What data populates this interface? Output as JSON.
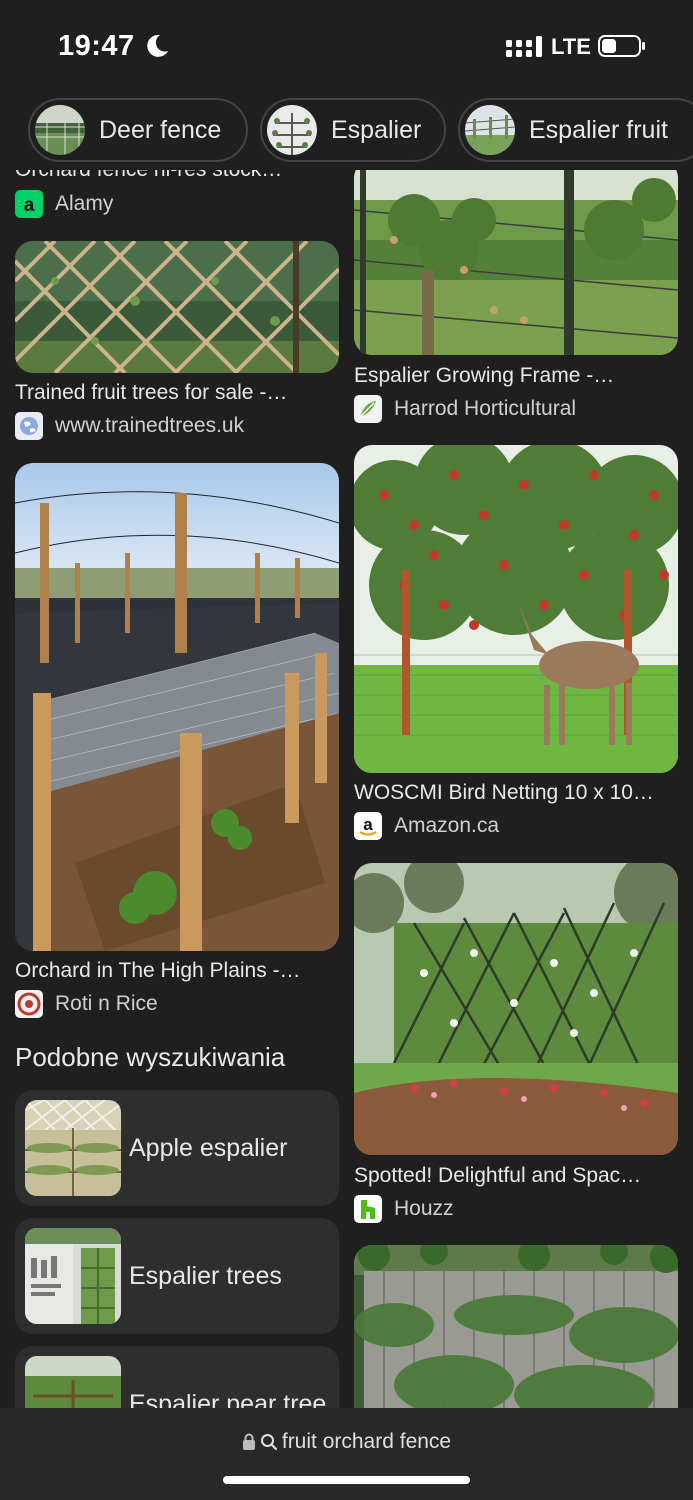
{
  "status": {
    "time": "19:47",
    "network": "LTE"
  },
  "chips": [
    {
      "label": "Deer fence",
      "thumb_icon": "fence-photo"
    },
    {
      "label": "Espalier",
      "thumb_icon": "espalier-photo"
    },
    {
      "label": "Espalier fruit",
      "thumb_icon": "espalier-fruit-photo"
    }
  ],
  "results": [
    {
      "title": "Orchard fence hi-res stock…",
      "source": "Alamy",
      "favicon": "alamy-icon"
    },
    {
      "title": "Trained fruit trees for sale -…",
      "source": "www.trainedtrees.uk",
      "favicon": "globe-icon"
    },
    {
      "title": "Orchard in The High Plains -…",
      "source": "Roti n Rice",
      "favicon": "roti-n-rice-icon"
    },
    {
      "title": "Espalier Growing Frame -…",
      "source": "Harrod Horticultural",
      "favicon": "harrod-icon"
    },
    {
      "title": "WOSCMI Bird Netting 10 x 10…",
      "source": "Amazon.ca",
      "favicon": "amazon-icon"
    },
    {
      "title": "Spotted! Delightful and Spac…",
      "source": "Houzz",
      "favicon": "houzz-icon"
    }
  ],
  "related": {
    "heading": "Podobne wyszukiwania",
    "items": [
      {
        "label": "Apple espalier"
      },
      {
        "label": "Espalier trees"
      },
      {
        "label": "Espalier pear tree"
      }
    ]
  },
  "address_bar": {
    "text": "fruit orchard fence"
  },
  "colors": {
    "background": "#1f1f1f",
    "card": "#2e2e2e",
    "text": "#e8e8e8",
    "houzz": "#4dbc15"
  }
}
